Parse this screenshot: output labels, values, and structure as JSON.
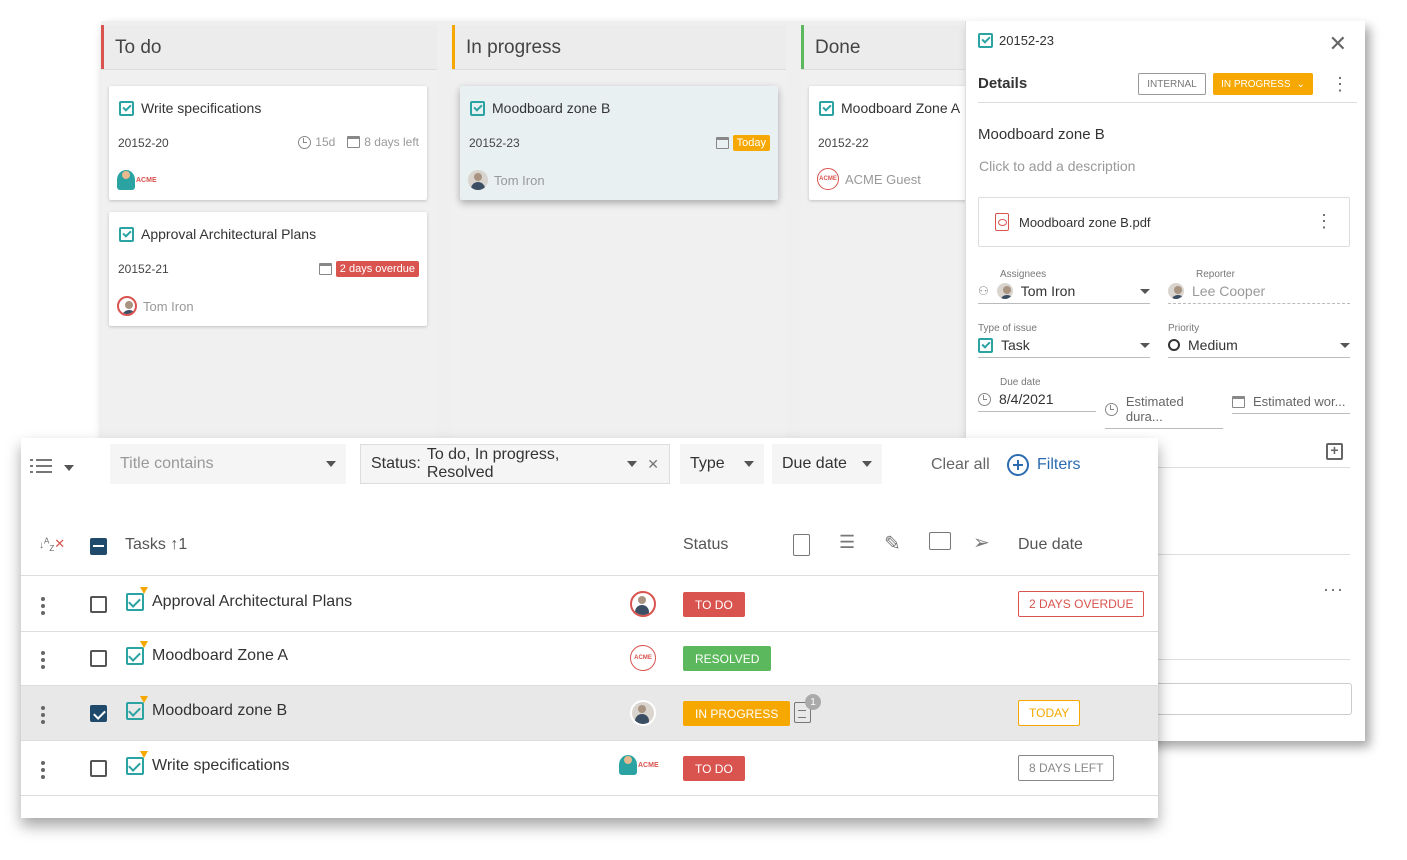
{
  "board": {
    "columns": [
      {
        "name": "To do",
        "color": "#d9534f"
      },
      {
        "name": "In progress",
        "color": "#f6a800"
      },
      {
        "name": "Done",
        "color": "#5cb85c"
      }
    ],
    "todo_cards": [
      {
        "title": "Write specifications",
        "code": "20152-20",
        "duration": "15d",
        "due": "8 days left",
        "assignee_logo": "ACME"
      },
      {
        "title": "Approval Architectural Plans",
        "code": "20152-21",
        "due": "2 days overdue",
        "assignee": "Tom Iron"
      }
    ],
    "progress_card": {
      "title": "Moodboard zone B",
      "code": "20152-23",
      "due": "Today",
      "assignee": "Tom Iron"
    },
    "done_card": {
      "title": "Moodboard Zone A",
      "code": "20152-22",
      "assignee": "ACME Guest",
      "assignee_logo": "ACME"
    }
  },
  "details": {
    "id": "20152-23",
    "section": "Details",
    "internal_tag": "INTERNAL",
    "status_tag": "IN PROGRESS",
    "title": "Moodboard zone B",
    "description_placeholder": "Click to add a description",
    "attachment": "Moodboard zone B.pdf",
    "assignees_label": "Assignees",
    "assignee": "Tom Iron",
    "reporter_label": "Reporter",
    "reporter": "Lee Cooper",
    "type_label": "Type of issue",
    "type": "Task",
    "priority_label": "Priority",
    "priority": "Medium",
    "due_label": "Due date",
    "due": "8/4/2021",
    "est_duration": "Estimated dura...",
    "est_work": "Estimated wor..."
  },
  "filters": {
    "title_placeholder": "Title contains",
    "status_label": "Status:",
    "status_value": "To do, In progress, Resolved",
    "type": "Type",
    "due": "Due date",
    "clear_all": "Clear all",
    "filters": "Filters"
  },
  "table": {
    "sort_label": "Tasks",
    "sort_order": "1",
    "status_header": "Status",
    "due_header": "Due date",
    "rows": [
      {
        "title": "Approval Architectural Plans",
        "status": "TO DO",
        "status_color": "#d9534f",
        "due": "2 DAYS OVERDUE",
        "due_color": "#d9534f",
        "selected": false
      },
      {
        "title": "Moodboard Zone A",
        "status": "RESOLVED",
        "status_color": "#5cb85c",
        "due": "",
        "selected": false,
        "assignee_logo": "ACME"
      },
      {
        "title": "Moodboard zone B",
        "status": "IN PROGRESS",
        "status_color": "#f6a800",
        "due": "TODAY",
        "due_color": "#f6a800",
        "selected": true,
        "doc_count": "1"
      },
      {
        "title": "Write specifications",
        "status": "TO DO",
        "status_color": "#d9534f",
        "due": "8 DAYS LEFT",
        "due_color": "#888888",
        "selected": false,
        "assignee_logo": "ACME"
      }
    ]
  }
}
